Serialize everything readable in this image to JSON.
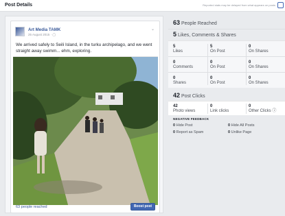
{
  "header": {
    "title": "Post Details",
    "notice": "Reported stats may be delayed from what appears on posts"
  },
  "post": {
    "author": "Art Media TAMK",
    "date": "25 August 2015 ·",
    "text": "We arrived safely to Seili Island, in the turku archipelago, and we went straight away swimm... ehm, exploring.",
    "people_reached_link": "63 people reached",
    "boost_label": "Boost post"
  },
  "stats": {
    "reached": {
      "count": "63",
      "label": "People Reached"
    },
    "engagement": {
      "count": "5",
      "label": "Likes, Comments & Shares"
    },
    "rows": [
      {
        "cells": [
          {
            "num": "5",
            "label": "Likes"
          },
          {
            "num": "5",
            "label": "On Post"
          },
          {
            "num": "0",
            "label": "On Shares"
          }
        ]
      },
      {
        "cells": [
          {
            "num": "0",
            "label": "Comments"
          },
          {
            "num": "0",
            "label": "On Post"
          },
          {
            "num": "0",
            "label": "On Shares"
          }
        ]
      },
      {
        "cells": [
          {
            "num": "0",
            "label": "Shares"
          },
          {
            "num": "0",
            "label": "On Post"
          },
          {
            "num": "0",
            "label": "On Shares"
          }
        ]
      }
    ],
    "clicks": {
      "count": "42",
      "label": "Post Clicks"
    },
    "click_cells": [
      {
        "num": "42",
        "label": "Photo views"
      },
      {
        "num": "0",
        "label": "Link clicks"
      },
      {
        "num": "0",
        "label": "Other Clicks"
      }
    ],
    "negative": {
      "title": "NEGATIVE FEEDBACK",
      "items": [
        {
          "num": "0",
          "label": "Hide Post"
        },
        {
          "num": "0",
          "label": "Hide All Posts"
        },
        {
          "num": "0",
          "label": "Report as Spam"
        },
        {
          "num": "0",
          "label": "Unlike Page"
        }
      ]
    }
  },
  "colors": {
    "accent": "#4267b2",
    "link": "#385898",
    "panel": "#f6f7f9"
  }
}
